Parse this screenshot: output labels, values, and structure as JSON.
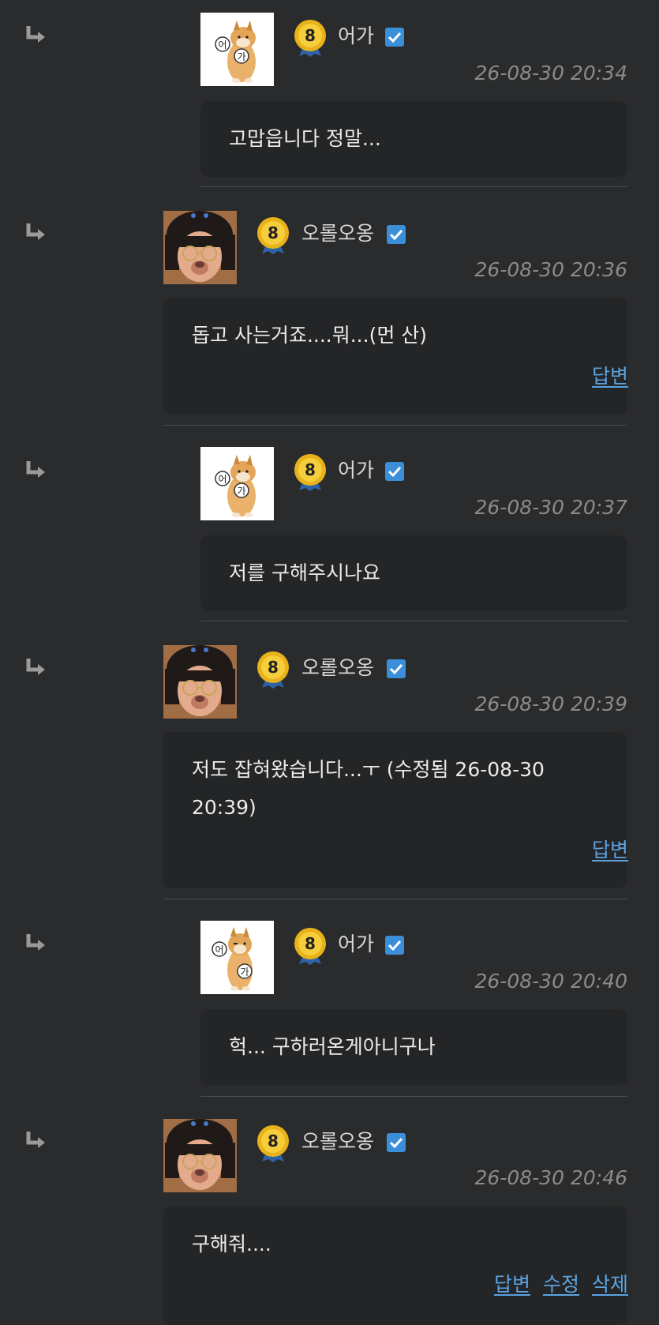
{
  "comments": [
    {
      "username": "어가",
      "level": "8",
      "timestamp": "26-08-30 20:34",
      "text": "고맙읍니다 정말...",
      "actions": []
    },
    {
      "username": "오롤오옹",
      "level": "8",
      "timestamp": "26-08-30 20:36",
      "text": "돕고 사는거죠....뭐...(먼 산)",
      "actions": [
        "답변"
      ]
    },
    {
      "username": "어가",
      "level": "8",
      "timestamp": "26-08-30 20:37",
      "text": "저를 구해주시나요",
      "actions": []
    },
    {
      "username": "오롤오옹",
      "level": "8",
      "timestamp": "26-08-30 20:39",
      "text": "저도 잡혀왔습니다...ㅜ (수정됨 26-08-30 20:39)",
      "actions": [
        "답변"
      ]
    },
    {
      "username": "어가",
      "level": "8",
      "timestamp": "26-08-30 20:40",
      "text": "헉... 구하러온게아니구나",
      "actions": []
    },
    {
      "username": "오롤오옹",
      "level": "8",
      "timestamp": "26-08-30 20:46",
      "text": "구해줘....",
      "actions": [
        "답변",
        "수정",
        "삭제"
      ]
    }
  ],
  "icons": {
    "reply_arrow": "reply-arrow-icon",
    "level_badge": "level-badge-icon",
    "verified": "verified-check-icon",
    "avatar_dog": "shiba-dog-avatar",
    "avatar_face": "person-face-avatar"
  },
  "colors": {
    "background": "#2a2b2c",
    "bubble": "#242526",
    "link": "#5aa3e0",
    "timestamp": "#8e8a85",
    "badge_gold": "#e8b21a",
    "verified_blue": "#3b8fd9"
  }
}
